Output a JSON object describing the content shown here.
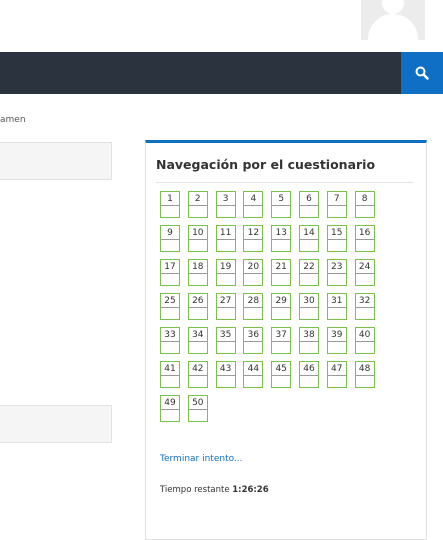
{
  "header": {
    "search_icon": "search-icon"
  },
  "breadcrumb": {
    "tail_text": "amen"
  },
  "quiz_navigation": {
    "title": "Navegación por el cuestionario",
    "questions": [
      "1",
      "2",
      "3",
      "4",
      "5",
      "6",
      "7",
      "8",
      "9",
      "10",
      "11",
      "12",
      "13",
      "14",
      "15",
      "16",
      "17",
      "18",
      "19",
      "20",
      "21",
      "22",
      "23",
      "24",
      "25",
      "26",
      "27",
      "28",
      "29",
      "30",
      "31",
      "32",
      "33",
      "34",
      "35",
      "36",
      "37",
      "38",
      "39",
      "40",
      "41",
      "42",
      "43",
      "44",
      "45",
      "46",
      "47",
      "48",
      "49",
      "50"
    ],
    "finish_link": "Terminar intento...",
    "time_label": "Tiempo restante",
    "time_value": "1:26:26"
  },
  "colors": {
    "navbar": "#2b333f",
    "accent": "#0f6fc5",
    "question_border": "#79c14b"
  }
}
